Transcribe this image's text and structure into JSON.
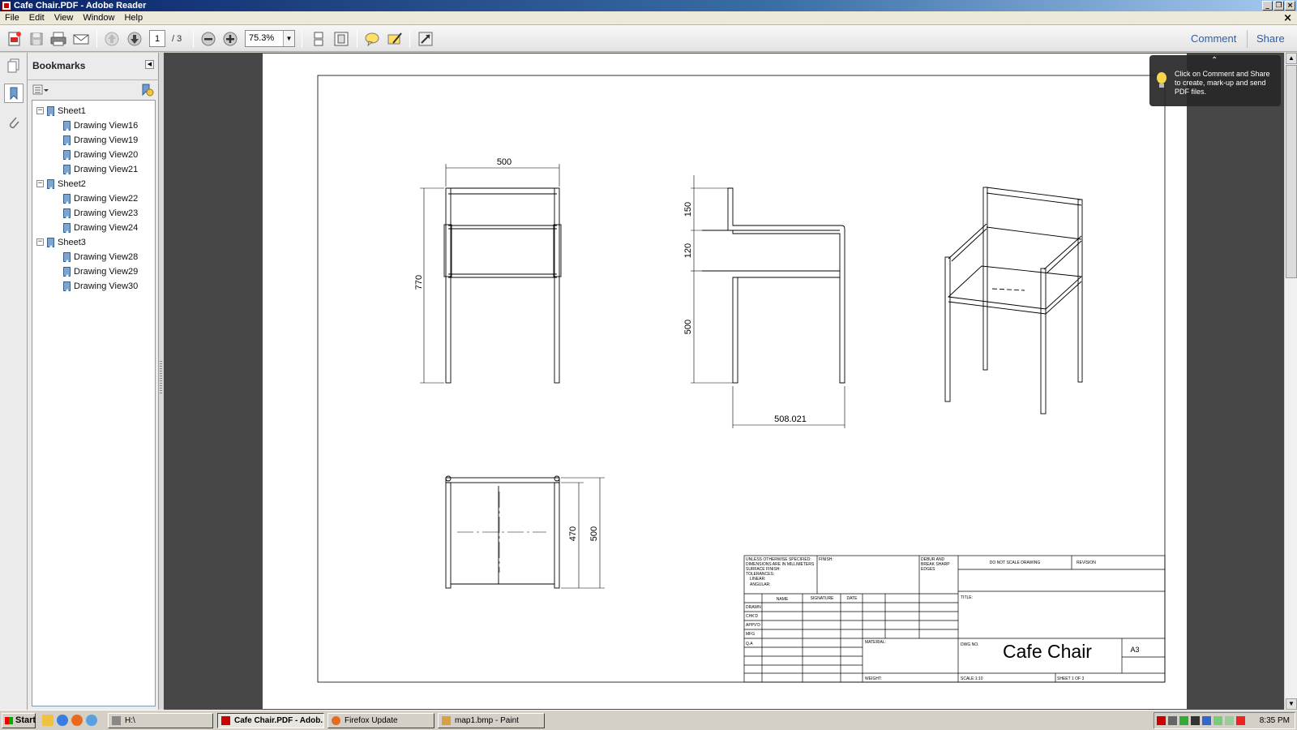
{
  "window": {
    "title": "Cafe Chair.PDF - Adobe Reader",
    "doc_close": "×"
  },
  "menu": [
    "File",
    "Edit",
    "View",
    "Window",
    "Help"
  ],
  "toolbar": {
    "page_current": "1",
    "page_total": "/ 3",
    "zoom": "75.3%",
    "comment_label": "Comment",
    "share_label": "Share"
  },
  "bookmarks": {
    "title": "Bookmarks",
    "items": [
      {
        "label": "Sheet1",
        "level": 0,
        "expanded": true
      },
      {
        "label": "Drawing View16",
        "level": 1
      },
      {
        "label": "Drawing View19",
        "level": 1
      },
      {
        "label": "Drawing View20",
        "level": 1
      },
      {
        "label": "Drawing View21",
        "level": 1
      },
      {
        "label": "Sheet2",
        "level": 0,
        "expanded": true
      },
      {
        "label": "Drawing View22",
        "level": 1
      },
      {
        "label": "Drawing View23",
        "level": 1
      },
      {
        "label": "Drawing View24",
        "level": 1
      },
      {
        "label": "Sheet3",
        "level": 0,
        "expanded": true
      },
      {
        "label": "Drawing View28",
        "level": 1
      },
      {
        "label": "Drawing View29",
        "level": 1
      },
      {
        "label": "Drawing View30",
        "level": 1
      }
    ]
  },
  "tooltip": {
    "text": "Click on Comment and Share to create, mark-up and send PDF files."
  },
  "drawing": {
    "dims": {
      "front_width": "500",
      "front_height": "770",
      "side_top": "150",
      "side_mid": "120",
      "side_low": "500",
      "side_depth": "508.021",
      "top_inner": "470",
      "top_outer": "500"
    },
    "title_block": {
      "notes": [
        "UNLESS OTHERWISE SPECIFIED:",
        "DIMENSIONS ARE IN MILLIMETERS",
        "SURFACE FINISH:",
        "TOLERANCES:",
        "LINEAR:",
        "ANGULAR:"
      ],
      "finish": "FINISH:",
      "deburr": [
        "DEBUR AND",
        "BREAK SHARP",
        "EDGES"
      ],
      "no_scale": "DO NOT SCALE DRAWING",
      "revision": "REVISION",
      "cols": [
        "NAME",
        "SIGNATURE",
        "DATE"
      ],
      "rows": [
        "DRAWN",
        "CHK'D",
        "APPV'D",
        "MFG",
        "Q.A"
      ],
      "title_label": "TITLE:",
      "material": "MATERIAL:",
      "dwg_no": "DWG NO.",
      "dwg_title": "Cafe Chair",
      "size": "A3",
      "weight": "WEIGHT:",
      "scale": "SCALE:1:10",
      "sheet": "SHEET 1 OF 3"
    }
  },
  "taskbar": {
    "start": "Start",
    "tasks": [
      "H:\\",
      "Cafe Chair.PDF - Adob...",
      "Firefox Update",
      "map1.bmp - Paint"
    ],
    "clock": "8:35 PM"
  }
}
